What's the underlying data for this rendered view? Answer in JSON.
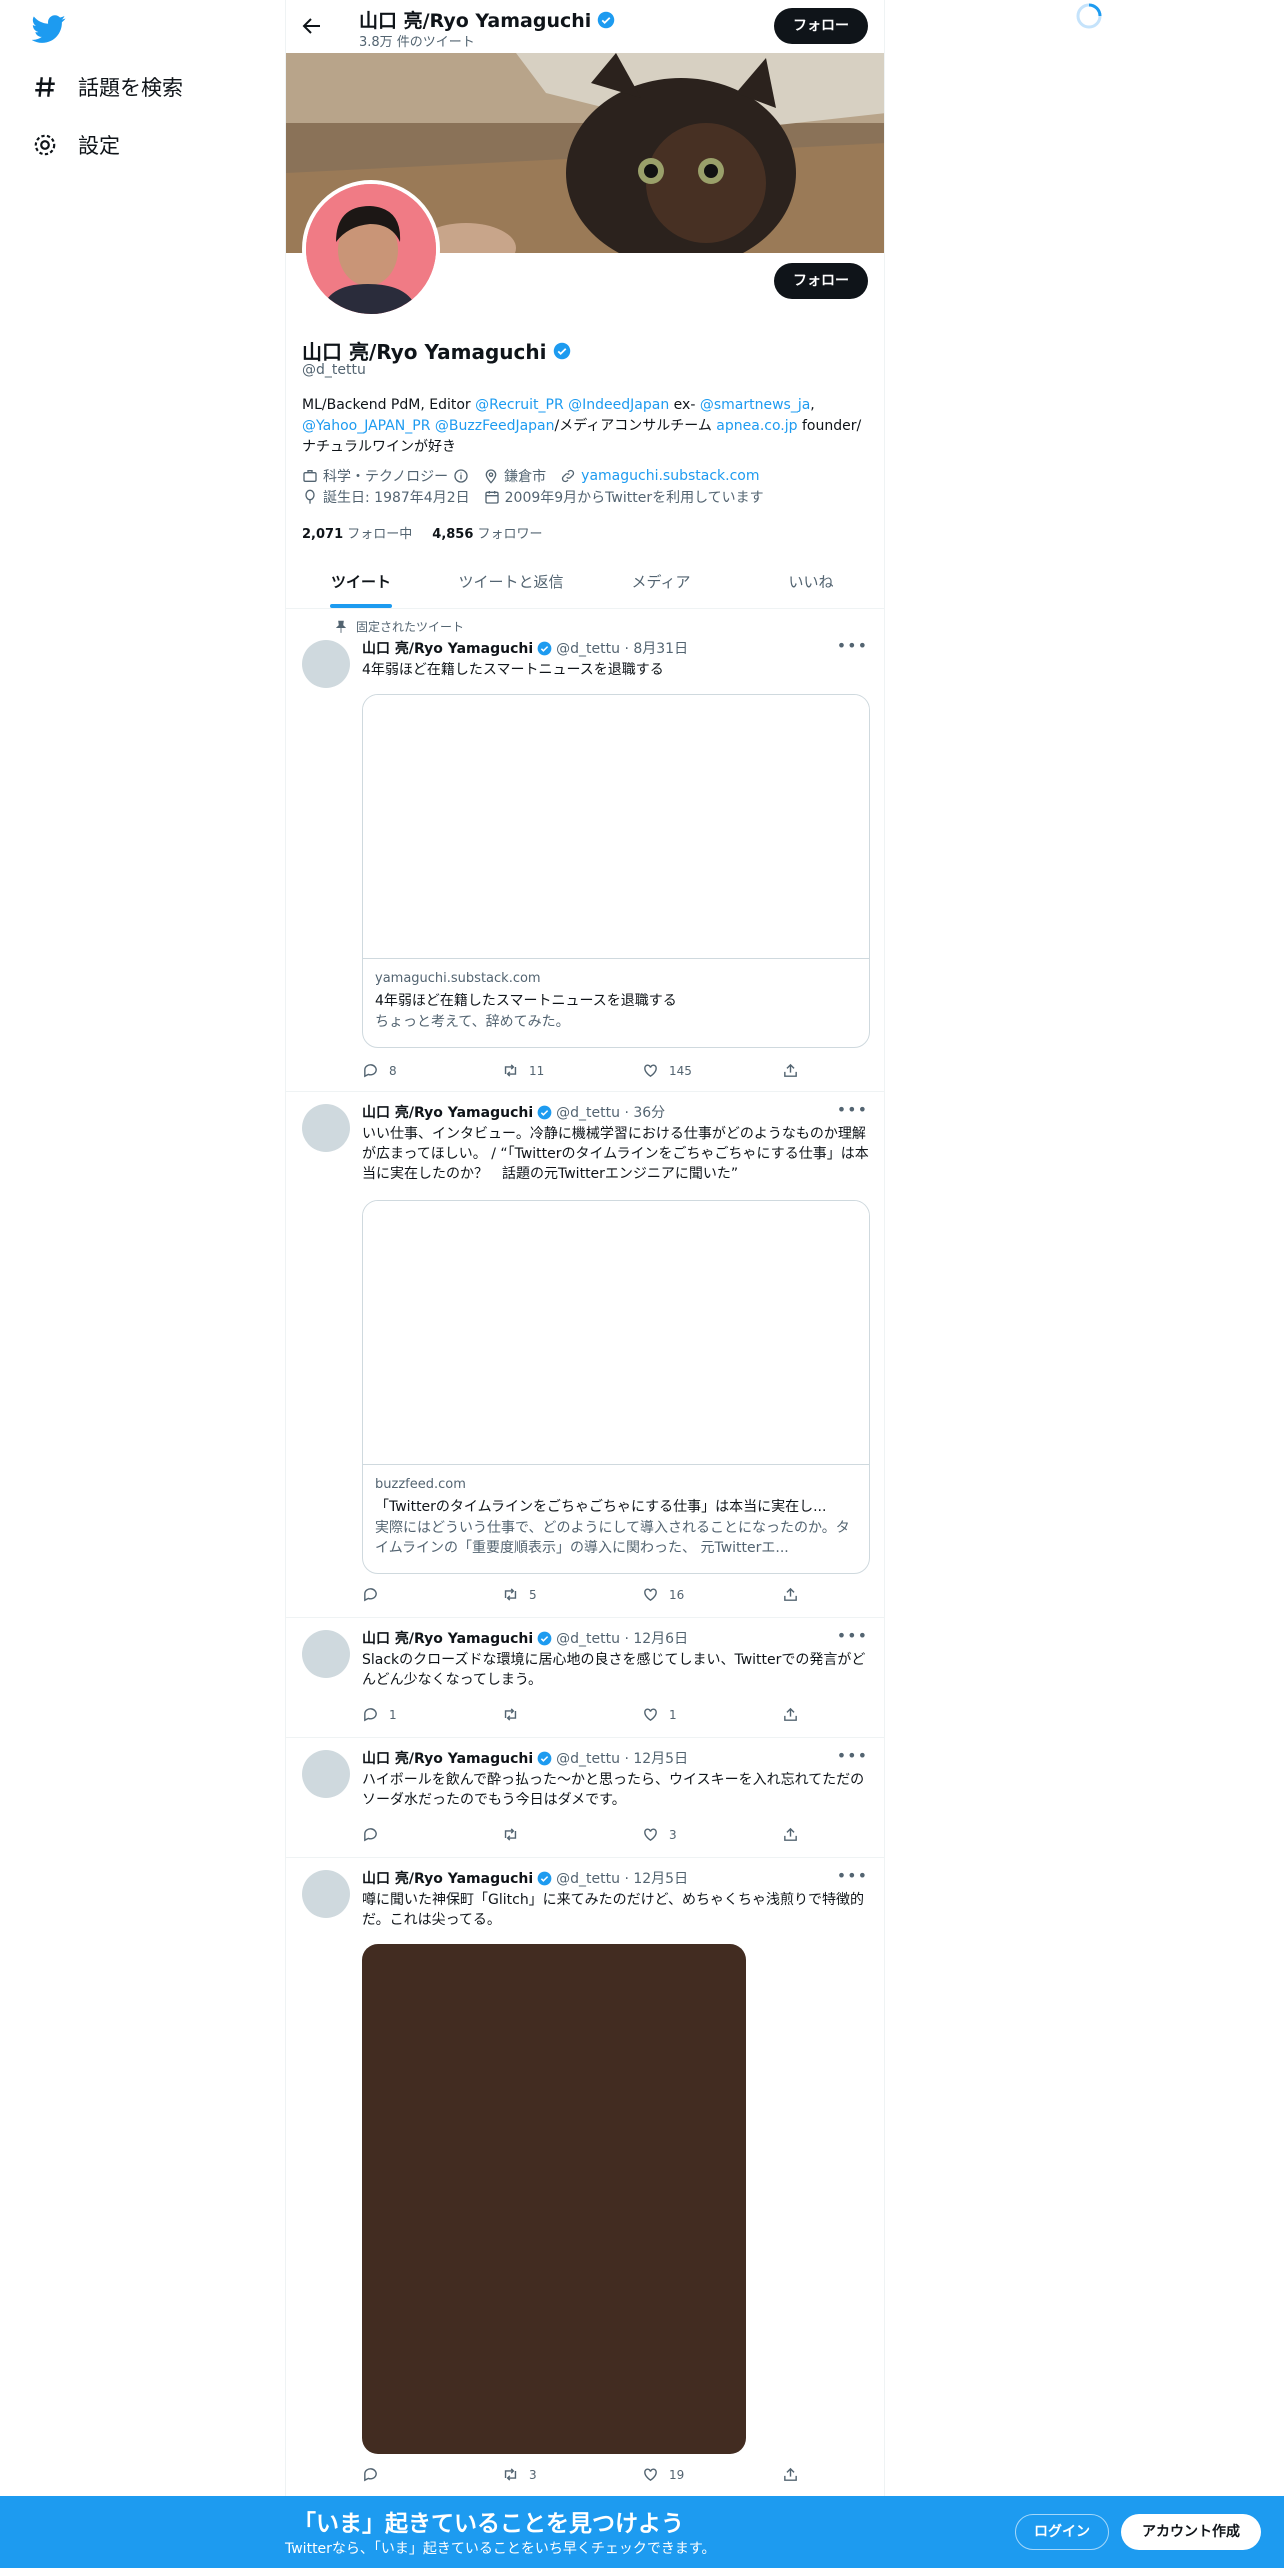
{
  "sidebar": {
    "logo_icon": "twitter-bird-icon",
    "items": [
      {
        "icon": "hashtag-icon",
        "label": "話題を検索"
      },
      {
        "icon": "gear-icon",
        "label": "設定"
      }
    ]
  },
  "header": {
    "name": "山口 亮/Ryo Yamaguchi",
    "tweet_count": "3.8万 件のツイート",
    "follow_label": "フォロー"
  },
  "profile": {
    "name": "山口 亮/Ryo Yamaguchi",
    "handle": "@d_tettu",
    "follow_label": "フォロー",
    "bio": {
      "p1": "ML/Backend PdM, Editor ",
      "l1": "@Recruit_PR",
      "l2": "@IndeedJapan",
      "p2": " ex- ",
      "l3": "@smartnews_ja",
      "p3": ",",
      "l4": "@Yahoo_JAPAN_PR",
      "l5": "@BuzzFeedJapan",
      "p4": "/メディアコンサルチーム ",
      "l6": "apnea.co.jp",
      "p5": " founder/",
      "p6": "ナチュラルワインが好き"
    },
    "category": "科学・テクノロジー",
    "location": "鎌倉市",
    "website": "yamaguchi.substack.com",
    "birthday": "誕生日: 1987年4月2日",
    "joined": "2009年9月からTwitterを利用しています",
    "following_count": "2,071",
    "following_label": "フォロー中",
    "followers_count": "4,856",
    "followers_label": "フォロワー"
  },
  "tabs": [
    "ツイート",
    "ツイートと返信",
    "メディア",
    "いいね"
  ],
  "pinned_label": "固定されたツイート",
  "tweets": [
    {
      "name": "山口 亮/Ryo Yamaguchi",
      "meta": "@d_tettu · 8月31日",
      "text": "4年弱ほど在籍したスマートニュースを退職する",
      "card": {
        "domain": "yamaguchi.substack.com",
        "title": "4年弱ほど在籍したスマートニュースを退職する",
        "desc": "ちょっと考えて、辞めてみた。"
      },
      "replies": "8",
      "retweets": "11",
      "likes": "145"
    },
    {
      "name": "山口 亮/Ryo Yamaguchi",
      "meta": "@d_tettu · 36分",
      "text": "いい仕事、インタビュー。冷静に機械学習における仕事がどのようなものか理解が広まってほしい。 / “「Twitterのタイムラインをごちゃごちゃにする仕事」は本当に実在したのか？　話題の元Twitterエンジニアに聞いた”",
      "card": {
        "domain": "buzzfeed.com",
        "title": "「Twitterのタイムラインをごちゃごちゃにする仕事」は本当に実在し...",
        "desc": "実際にはどういう仕事で、どのようにして導入されることになったのか。タイムラインの「重要度順表示」の導入に関わった、 元Twitterエ..."
      },
      "replies": "",
      "retweets": "5",
      "likes": "16"
    },
    {
      "name": "山口 亮/Ryo Yamaguchi",
      "meta": "@d_tettu · 12月6日",
      "text": "Slackのクローズドな環境に居心地の良さを感じてしまい、Twitterでの発言がどんどん少なくなってしまう。",
      "replies": "1",
      "retweets": "",
      "likes": "1"
    },
    {
      "name": "山口 亮/Ryo Yamaguchi",
      "meta": "@d_tettu · 12月5日",
      "text": "ハイボールを飲んで酔っ払った〜かと思ったら、ウイスキーを入れ忘れてただのソーダ水だったのでもう今日はダメです。",
      "replies": "",
      "retweets": "",
      "likes": "3"
    },
    {
      "name": "山口 亮/Ryo Yamaguchi",
      "meta": "@d_tettu · 12月5日",
      "text": "噂に聞いた神保町「Glitch」に来てみたのだけど、めちゃくちゃ浅煎りで特徴的だ。これは尖ってる。",
      "replies": "",
      "retweets": "3",
      "likes": "19"
    }
  ],
  "bottom": {
    "title": "「いま」起きていることを見つけよう",
    "subtitle": "Twitterなら、「いま」起きていることをいち早くチェックできます。",
    "login": "ログイン",
    "signup": "アカウント作成"
  },
  "colors": {
    "accent": "#1d9bf0",
    "text": "#0f1419",
    "muted": "#536471"
  }
}
